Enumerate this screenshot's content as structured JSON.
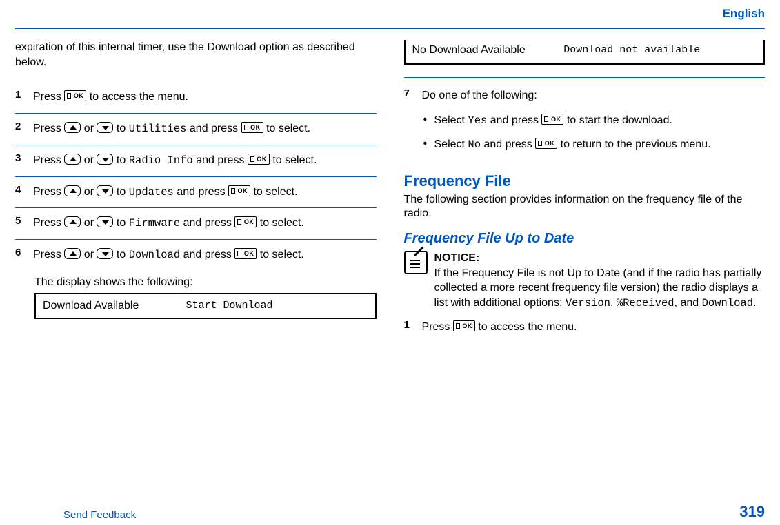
{
  "header": {
    "lang": "English"
  },
  "left": {
    "intro": "expiration of this internal timer, use the Download option as described below.",
    "steps": [
      {
        "n": "1",
        "pre": "Press ",
        "post": " to access the menu."
      },
      {
        "n": "2",
        "pre": "Press ",
        "mid1": " or ",
        "mid2": " to ",
        "target": "Utilities",
        "mid3": " and press ",
        "post": " to select."
      },
      {
        "n": "3",
        "pre": "Press ",
        "mid1": " or ",
        "mid2": " to ",
        "target": "Radio Info",
        "mid3": " and press ",
        "post": " to select."
      },
      {
        "n": "4",
        "pre": "Press ",
        "mid1": " or ",
        "mid2": " to ",
        "target": "Updates",
        "mid3": " and press ",
        "post": " to select."
      },
      {
        "n": "5",
        "pre": "Press ",
        "mid1": " or ",
        "mid2": " to ",
        "target": "Firmware",
        "mid3": " and press ",
        "post": " to select."
      },
      {
        "n": "6",
        "pre": "Press ",
        "mid1": " or ",
        "mid2": " to ",
        "target": "Download",
        "mid3": " and press ",
        "post": " to select.",
        "result": "The display shows the following:"
      }
    ],
    "display": {
      "row1_label": "Download Available",
      "row1_value": "Start Download"
    }
  },
  "right": {
    "topbox": {
      "label": "No Download Available",
      "value": "Download not available"
    },
    "step7": {
      "n": "7",
      "lead": "Do one of the following:",
      "bullets": [
        {
          "pre": "Select ",
          "opt": "Yes",
          "mid": " and press ",
          "post": " to start the download."
        },
        {
          "pre": "Select ",
          "opt": "No",
          "mid": " and press ",
          "post": " to return to the previous menu."
        }
      ]
    },
    "section": {
      "title": "Frequency File",
      "desc": "The following section provides information on the frequency file of the radio."
    },
    "subsection": {
      "title": "Frequency File Up to Date",
      "notice_label": "NOTICE:",
      "notice_body_a": "If the Frequency File is not Up to Date (and if the radio has partially collected a more recent frequency file version) the radio displays a list with additional options; ",
      "opt1": "Version",
      "sep1": ", ",
      "opt2": "%Received",
      "sep2": ", and ",
      "opt3": "Download",
      "tail": "."
    },
    "freq_step1": {
      "n": "1",
      "pre": "Press ",
      "post": " to access the menu."
    }
  },
  "footer": {
    "send": "Send Feedback",
    "page": "319"
  }
}
